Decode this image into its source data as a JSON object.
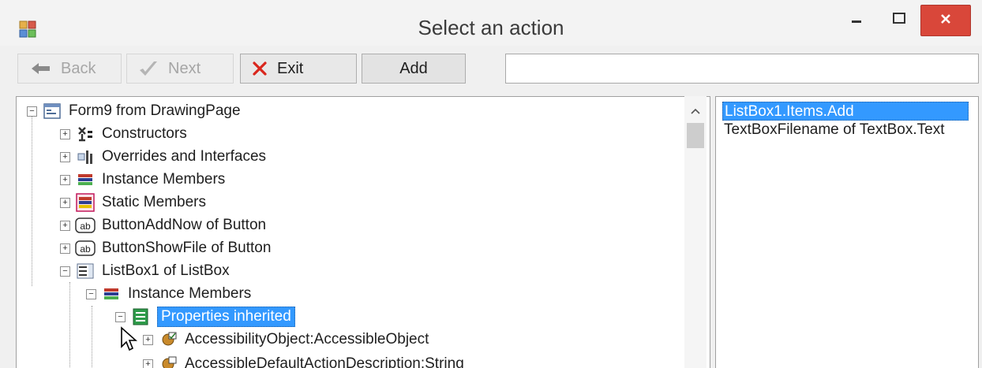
{
  "window": {
    "title": "Select an action",
    "colors": {
      "close_button": "#d9473a",
      "selection": "#3399ff"
    }
  },
  "toolbar": {
    "back_label": "Back",
    "next_label": "Next",
    "exit_label": "Exit",
    "add_label": "Add",
    "input_value": ""
  },
  "tree": {
    "items": [
      {
        "label": "Form9 from DrawingPage",
        "icon": "form-icon"
      },
      {
        "label": "Constructors",
        "icon": "constructors-icon"
      },
      {
        "label": "Overrides and Interfaces",
        "icon": "overrides-icon"
      },
      {
        "label": "Instance Members",
        "icon": "instance-members-icon"
      },
      {
        "label": "Static Members",
        "icon": "static-members-icon"
      },
      {
        "label": "ButtonAddNow of Button",
        "icon": "button-control-icon"
      },
      {
        "label": "ButtonShowFile of Button",
        "icon": "button-control-icon"
      },
      {
        "label": "ListBox1 of ListBox",
        "icon": "listbox-control-icon"
      },
      {
        "label": "Instance Members",
        "icon": "instance-members-icon"
      },
      {
        "label": "Properties inherited",
        "icon": "properties-icon"
      },
      {
        "label": "AccessibilityObject:AccessibleObject",
        "icon": "property-object-icon"
      },
      {
        "label": "AccessibleDefaultActionDescription:String",
        "icon": "property-string-icon"
      }
    ]
  },
  "list": {
    "items": [
      {
        "label": "ListBox1.Items.Add",
        "selected": true
      },
      {
        "label": "TextBoxFilename of TextBox.Text",
        "selected": false
      }
    ]
  }
}
